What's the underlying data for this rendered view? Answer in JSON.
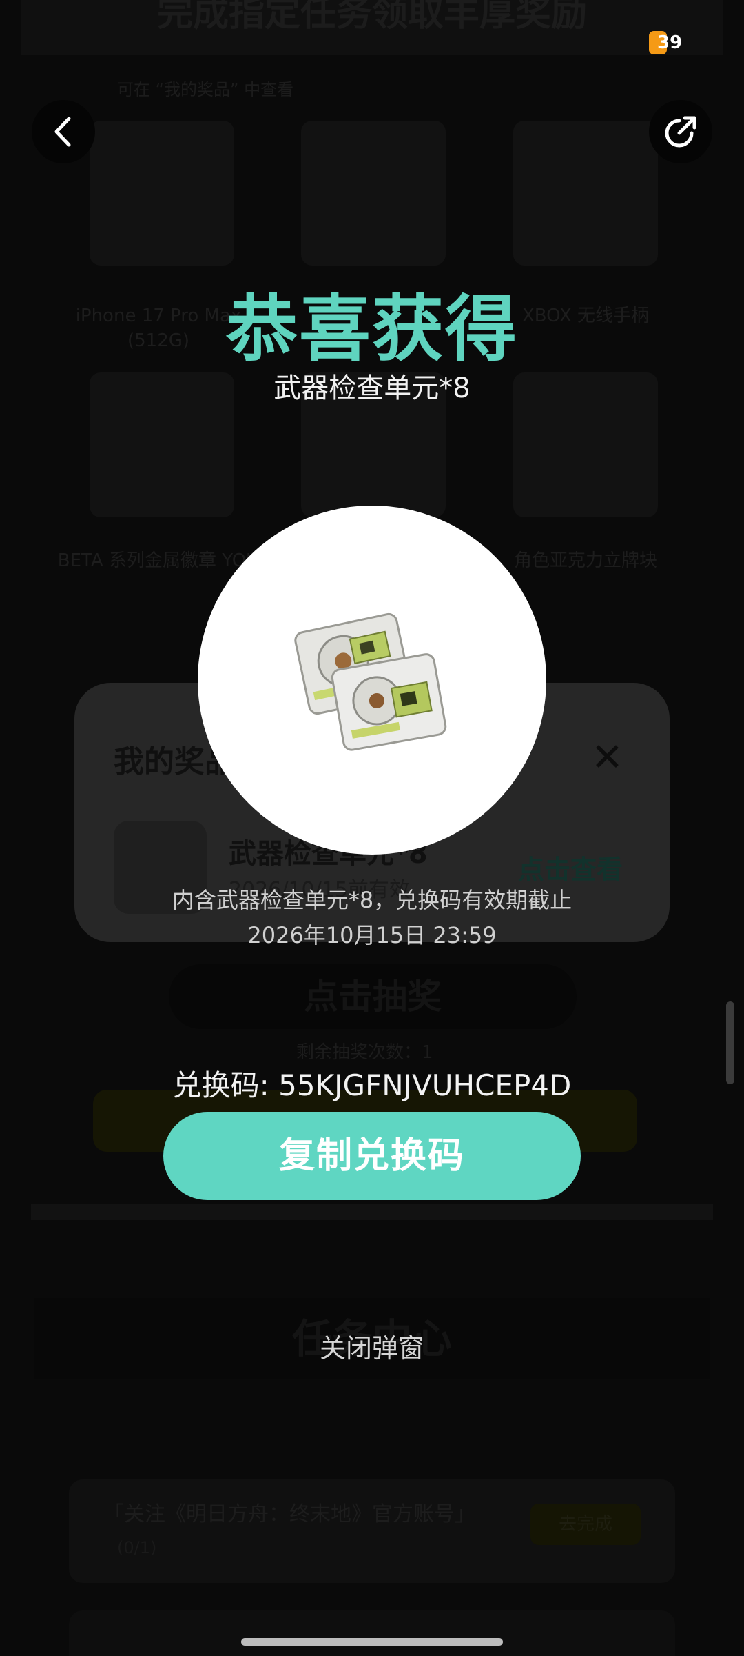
{
  "background": {
    "banner_text": "完成指定任务领取丰厚奖励",
    "filter_text": "可在 “我的奖品” 中查看",
    "prize_items": [
      "iPhone 17 Pro Max (512G)",
      "",
      "XBOX 无线手柄",
      "BETA 系列金属徽章 YOU",
      "",
      "角色亚克力立牌块"
    ],
    "my_prizes": {
      "title": "我的奖品",
      "item_name": "武器检查单元*8",
      "item_expiry": "2026/10/15前有效",
      "view_link": "点击查看"
    },
    "draw_button": "点击抽奖",
    "remaining": "剩余抽奖次数：1",
    "task_center_title": "任务中心",
    "task": {
      "title": "「关注《明日方舟：终末地》官方账号」",
      "progress": "(0/1)",
      "button": "去完成"
    }
  },
  "status": {
    "badge_count": "39"
  },
  "modal": {
    "title": "恭喜获得",
    "prize_name": "武器检查单元*8",
    "description": "内含武器检查单元*8，兑换码有效期截止 2026年10月15日 23:59",
    "code_label": "兑换码: 55KJGFNJVUHCEP4D",
    "copy_button": "复制兑换码",
    "close_label": "关闭弹窗"
  },
  "icons": {
    "back": "chevron-left-icon",
    "share": "share-icon",
    "prize": "weapon-inspection-unit-icon"
  }
}
